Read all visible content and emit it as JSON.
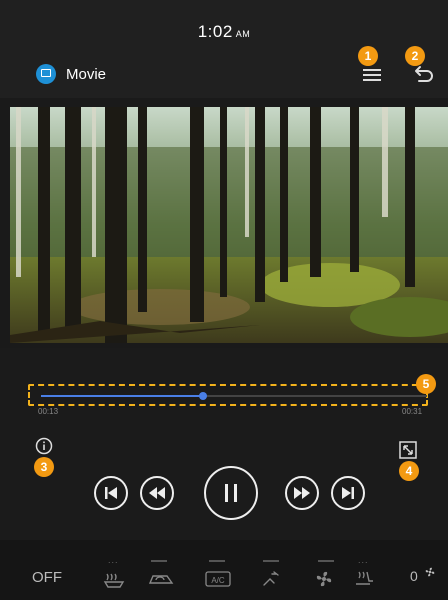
{
  "status": {
    "time": "1:02",
    "ampm": "AM"
  },
  "header": {
    "title": "Movie"
  },
  "badges": [
    "1",
    "2",
    "3",
    "4",
    "5"
  ],
  "player": {
    "current_time": "00:13",
    "total_time": "00:31",
    "progress": 0.42
  },
  "climate": {
    "off_label": "OFF",
    "ac_label": "A/C",
    "fan_level": "0"
  },
  "icons": {
    "menu": "menu-icon",
    "back": "back-arrow-icon",
    "info": "info-icon",
    "fullscreen": "fullscreen-icon",
    "prev": "skip-previous-icon",
    "rewind": "rewind-icon",
    "pause": "pause-icon",
    "forward": "fast-forward-icon",
    "next": "skip-next-icon"
  },
  "colors": {
    "accent": "#4a7fe6",
    "badge": "#f39a12",
    "highlight": "#f2b21c",
    "app_icon": "#1e90d6"
  }
}
